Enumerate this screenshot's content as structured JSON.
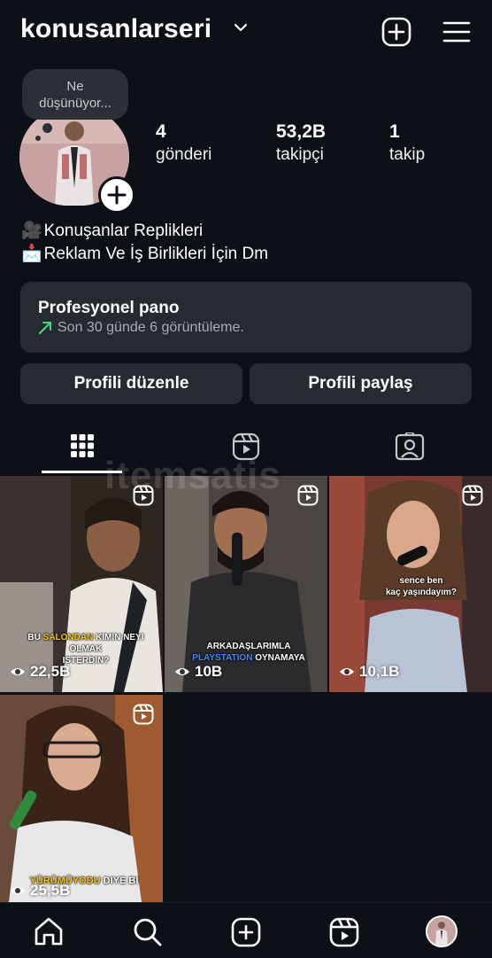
{
  "header": {
    "username": "konusanlarseri",
    "icons": [
      "chevron-down-icon",
      "new-post-icon",
      "menu-icon"
    ]
  },
  "note": {
    "text_line1": "Ne",
    "text_line2": "düşünüyor..."
  },
  "stats": [
    {
      "value": "4",
      "label": "gönderi"
    },
    {
      "value": "53,2B",
      "label": "takipçi"
    },
    {
      "value": "1",
      "label": "takip"
    }
  ],
  "bio": {
    "line1_emoji": "🎥",
    "line1": "Konuşanlar Replikleri",
    "line2_emoji": "📩",
    "line2": "Reklam Ve İş Birlikleri İçin Dm"
  },
  "dashboard": {
    "title": "Profesyonel pano",
    "subtitle": "Son 30 günde 6 görüntüleme."
  },
  "buttons": {
    "edit": "Profili düzenle",
    "share": "Profili paylaş"
  },
  "tabs": [
    "grid-icon",
    "reels-icon",
    "tagged-icon"
  ],
  "posts": [
    {
      "views": "22,5B",
      "caption_hl": "SALONDAN",
      "caption_pre": "BU ",
      "caption_post": " KIMIN NEYI OLMAK",
      "caption_line2": "ISTERDIN?"
    },
    {
      "views": "10B",
      "caption_line1": "ARKADAŞLARIMLA",
      "caption_hl": "PLAYSTATION",
      "caption_post": " OYNAMAYA"
    },
    {
      "views": "10,1B",
      "caption_line1": "sence ben",
      "caption_line2": "kaç yaşındayım?"
    },
    {
      "views": "25,5B",
      "caption_hl": "YÜRÜMÜYODU",
      "caption_post": " DIYE BI"
    }
  ],
  "watermark": "itemsatis",
  "bottom_nav": [
    "home-icon",
    "search-icon",
    "create-icon",
    "reels-icon",
    "profile-avatar"
  ],
  "colors": {
    "background": "#0d1117",
    "card": "#262a31",
    "accent_green": "#3ddc84"
  }
}
